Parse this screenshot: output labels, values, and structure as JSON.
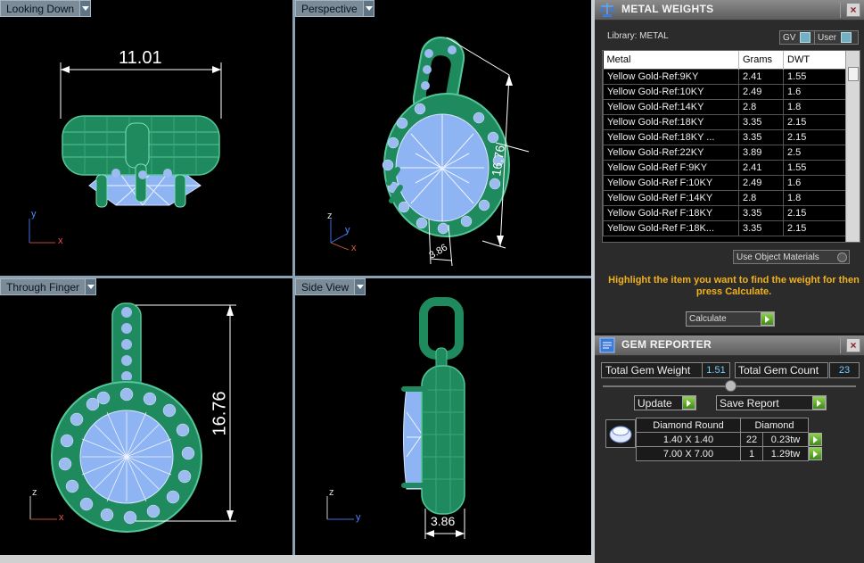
{
  "viewports": {
    "top_left": {
      "label": "Looking Down",
      "dim_label": "11.01",
      "axes": [
        "y",
        "x"
      ]
    },
    "top_right": {
      "label": "Perspective",
      "dim_label_a": "16.76",
      "dim_label_b": "3.86",
      "axes": [
        "z",
        "y",
        "x"
      ]
    },
    "bottom_left": {
      "label": "Through Finger",
      "dim_label": "16.76",
      "axes": [
        "z",
        "x"
      ]
    },
    "bottom_right": {
      "label": "Side View",
      "dim_label": "3.86",
      "axes": [
        "z",
        "y"
      ]
    }
  },
  "metal_weights": {
    "title": "METAL WEIGHTS",
    "library": "Library: METAL",
    "toggle_gv": "GV",
    "toggle_user": "User",
    "columns": [
      "Metal",
      "Grams",
      "DWT"
    ],
    "rows": [
      [
        "Yellow Gold-Ref:9KY",
        "2.41",
        "1.55"
      ],
      [
        "Yellow Gold-Ref:10KY",
        "2.49",
        "1.6"
      ],
      [
        "Yellow Gold-Ref:14KY",
        "2.8",
        "1.8"
      ],
      [
        "Yellow Gold-Ref:18KY",
        "3.35",
        "2.15"
      ],
      [
        "Yellow Gold-Ref:18KY ...",
        "3.35",
        "2.15"
      ],
      [
        "Yellow Gold-Ref:22KY",
        "3.89",
        "2.5"
      ],
      [
        "Yellow Gold-Ref F:9KY",
        "2.41",
        "1.55"
      ],
      [
        "Yellow Gold-Ref F:10KY",
        "2.49",
        "1.6"
      ],
      [
        "Yellow Gold-Ref F:14KY",
        "2.8",
        "1.8"
      ],
      [
        "Yellow Gold-Ref F:18KY",
        "3.35",
        "2.15"
      ],
      [
        "Yellow Gold-Ref F:18K...",
        "3.35",
        "2.15"
      ]
    ],
    "use_object_materials": "Use Object Materials",
    "hint": "Highlight the item you want to find the weight for then press Calculate.",
    "calculate": "Calculate"
  },
  "gem_reporter": {
    "title": "GEM REPORTER",
    "total_weight_label": "Total Gem Weight",
    "total_weight_value": "1.51",
    "total_count_label": "Total Gem Count",
    "total_count_value": "23",
    "update": "Update",
    "save_report": "Save Report",
    "header": [
      "Diamond Round",
      "Diamond"
    ],
    "rows": [
      [
        "1.40 X 1.40",
        "22",
        "0.23tw"
      ],
      [
        "7.00 X 7.00",
        "1",
        "1.29tw"
      ]
    ]
  },
  "colors": {
    "metal": "#1f8a5e",
    "gem": "#8fb4f4",
    "dim": "#ffffff",
    "hint": "#f2b21c"
  }
}
